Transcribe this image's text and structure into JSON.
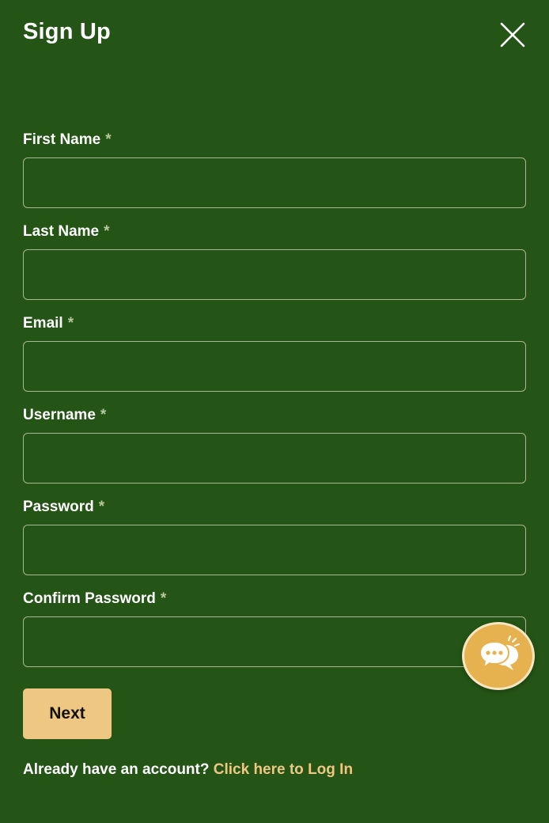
{
  "header": {
    "title": "Sign Up",
    "close_icon": "close-icon"
  },
  "form": {
    "required_marker": "*",
    "fields": [
      {
        "label": "First Name",
        "value": "",
        "placeholder": ""
      },
      {
        "label": "Last Name",
        "value": "",
        "placeholder": ""
      },
      {
        "label": "Email",
        "value": "",
        "placeholder": ""
      },
      {
        "label": "Username",
        "value": "",
        "placeholder": ""
      },
      {
        "label": "Password",
        "value": "",
        "placeholder": ""
      },
      {
        "label": "Confirm Password",
        "value": "",
        "placeholder": ""
      }
    ],
    "next_label": "Next"
  },
  "footer": {
    "prompt": "Already have an account?",
    "login_link": "Click here to Log In"
  },
  "chat": {
    "icon": "chat-bubbles-icon"
  },
  "colors": {
    "background": "#245416",
    "accent": "#eec882",
    "chat_button": "#e6b250",
    "input_border": "#a9b891"
  }
}
